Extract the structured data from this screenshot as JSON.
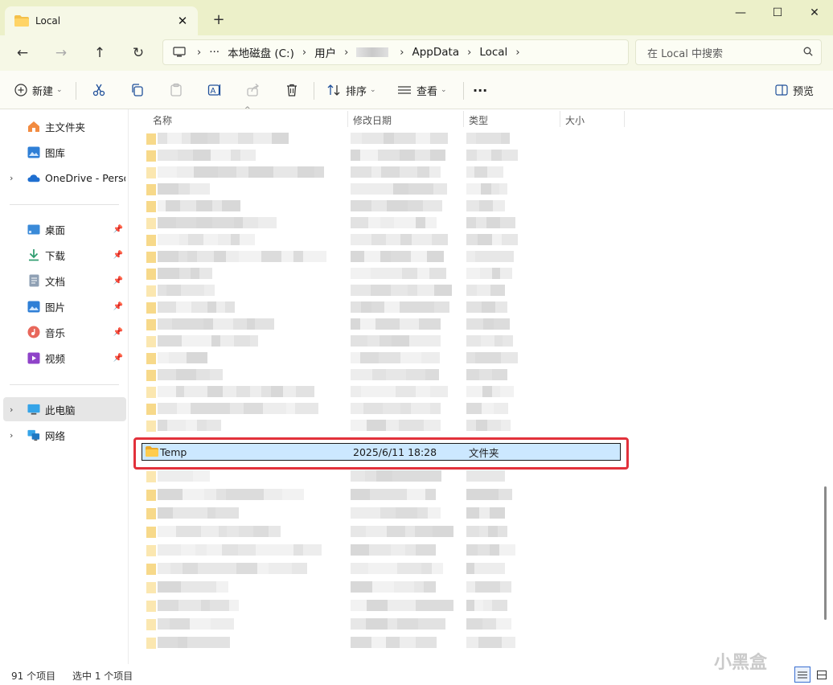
{
  "window": {
    "tab_title": "Local",
    "minimize": "—",
    "maximize": "☐",
    "close": "✕",
    "tab_close": "✕",
    "new_tab": "+"
  },
  "nav": {
    "back": "←",
    "forward": "→",
    "up": "↑",
    "refresh": "↻"
  },
  "address": {
    "more": "···",
    "crumbs": [
      "本地磁盘 (C:)",
      "用户",
      "AppData",
      "Local"
    ],
    "separator": "›"
  },
  "search": {
    "placeholder": "在 Local 中搜索"
  },
  "toolbar": {
    "new_label": "新建",
    "sort_label": "排序",
    "view_label": "查看",
    "more_label": "···",
    "preview_label": "预览"
  },
  "sidebar": {
    "items": [
      {
        "label": "主文件夹"
      },
      {
        "label": "图库"
      },
      {
        "label": "OneDrive - Personal"
      },
      {
        "label": "桌面"
      },
      {
        "label": "下载"
      },
      {
        "label": "文档"
      },
      {
        "label": "图片"
      },
      {
        "label": "音乐"
      },
      {
        "label": "视频"
      },
      {
        "label": "此电脑"
      },
      {
        "label": "网络"
      }
    ]
  },
  "columns": {
    "name": "名称",
    "modified": "修改日期",
    "type": "类型",
    "size": "大小"
  },
  "selected_row": {
    "name": "Temp",
    "modified": "2025/6/11 18:28",
    "type": "文件夹"
  },
  "status": {
    "count": "91 个项目",
    "selected": "选中 1 个项目"
  },
  "watermark": "小黑盒",
  "colors": {
    "accent": "#cce8ff",
    "highlight": "#e2313b",
    "titlebar": "#ecf0c9",
    "folder": "#f4c04a"
  }
}
